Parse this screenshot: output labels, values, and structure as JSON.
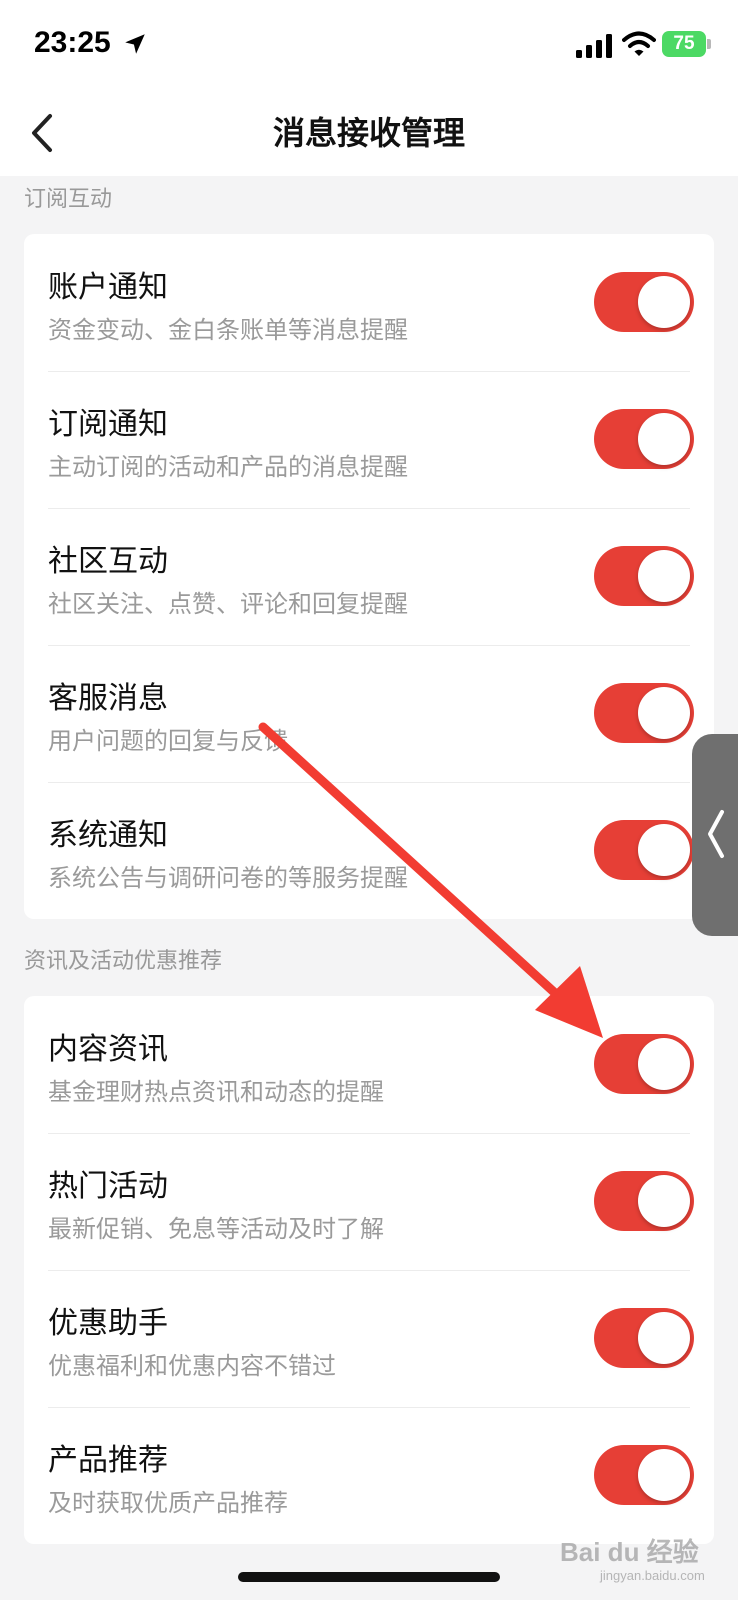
{
  "status_bar": {
    "time": "23:25",
    "battery": "75",
    "icons": [
      "location-arrow-icon",
      "signal-icon",
      "wifi-icon",
      "battery-charging-icon"
    ]
  },
  "nav": {
    "title": "消息接收管理",
    "back_icon": "chevron-left-icon"
  },
  "sections": [
    {
      "label": "订阅互动",
      "items": [
        {
          "title": "账户通知",
          "subtitle": "资金变动、金白条账单等消息提醒",
          "enabled": true
        },
        {
          "title": "订阅通知",
          "subtitle": "主动订阅的活动和产品的消息提醒",
          "enabled": true
        },
        {
          "title": "社区互动",
          "subtitle": "社区关注、点赞、评论和回复提醒",
          "enabled": true
        },
        {
          "title": "客服消息",
          "subtitle": "用户问题的回复与反馈",
          "enabled": true
        },
        {
          "title": "系统通知",
          "subtitle": "系统公告与调研问卷的等服务提醒",
          "enabled": true
        }
      ]
    },
    {
      "label": "资讯及活动优惠推荐",
      "items": [
        {
          "title": "内容资讯",
          "subtitle": "基金理财热点资讯和动态的提醒",
          "enabled": true
        },
        {
          "title": "热门活动",
          "subtitle": "最新促销、免息等活动及时了解",
          "enabled": true
        },
        {
          "title": "优惠助手",
          "subtitle": "优惠福利和优惠内容不错过",
          "enabled": true
        },
        {
          "title": "产品推荐",
          "subtitle": "及时获取优质产品推荐",
          "enabled": true
        }
      ]
    }
  ],
  "watermark": {
    "brand": "Bai du 经验",
    "url": "jingyan.baidu.com"
  },
  "colors": {
    "toggle_on": "#e63f36",
    "annotation_arrow": "#f23c32",
    "background": "#f4f4f5"
  }
}
